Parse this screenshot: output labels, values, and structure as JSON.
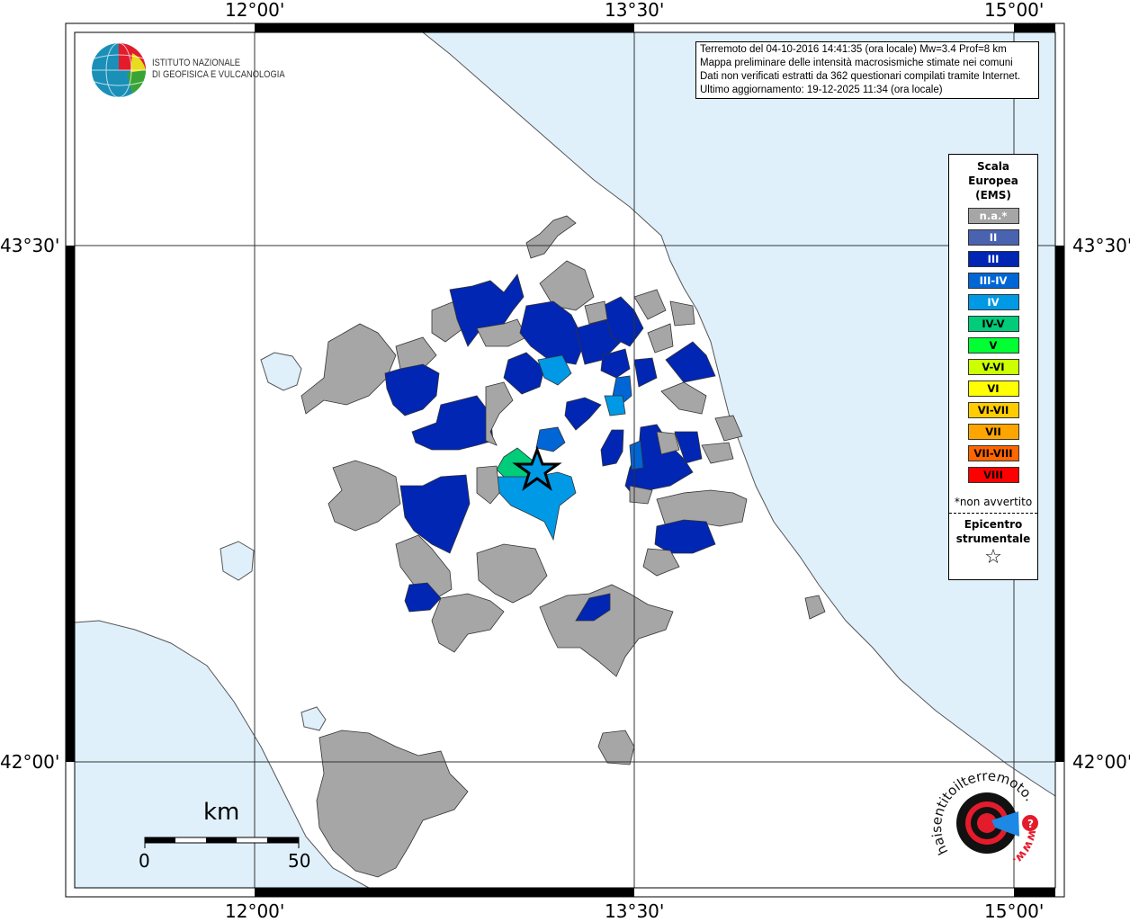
{
  "map": {
    "lon_ticks": [
      "12°00'",
      "13°30'",
      "15°00'"
    ],
    "lat_ticks": [
      "43°30'",
      "42°00'"
    ],
    "sea_color": "#dff0fb",
    "land_color": "#ffffff",
    "na_color": "#a6a6a6"
  },
  "info": {
    "line1": "Terremoto del 04-10-2016 14:41:35 (ora locale) Mw=3.4 Prof=8 km",
    "line2": "Mappa preliminare delle intensità macrosismiche stimate nei comuni",
    "line3": "Dati non verificati estratti da 362 questionari compilati tramite Internet.",
    "line4": "Ultimo aggiornamento: 19-12-2025 11:34 (ora locale)"
  },
  "logo": {
    "ingv_line1": "ISTITUTO NAZIONALE",
    "ingv_line2": "DI GEOFISICA E VULCANOLOGIA",
    "hst": "www.haisentitoilterremoto.it"
  },
  "legend": {
    "title1": "Scala",
    "title2": "Europea",
    "title3": "(EMS)",
    "classes": [
      {
        "label": "n.a.*",
        "color": "#a6a6a6",
        "text": "#ffffff"
      },
      {
        "label": "II",
        "color": "#4a63b0",
        "text": "#ffffff"
      },
      {
        "label": "III",
        "color": "#0026b3",
        "text": "#ffffff"
      },
      {
        "label": "III-IV",
        "color": "#0066d6",
        "text": "#ffffff"
      },
      {
        "label": "IV",
        "color": "#0099e6",
        "text": "#ffffff"
      },
      {
        "label": "IV-V",
        "color": "#00cc7a",
        "text": "#000000"
      },
      {
        "label": "V",
        "color": "#00ff33",
        "text": "#000000"
      },
      {
        "label": "V-VI",
        "color": "#ccff00",
        "text": "#000000"
      },
      {
        "label": "VI",
        "color": "#ffff00",
        "text": "#000000"
      },
      {
        "label": "VI-VII",
        "color": "#ffcc00",
        "text": "#000000"
      },
      {
        "label": "VII",
        "color": "#ffa500",
        "text": "#000000"
      },
      {
        "label": "VII-VIII",
        "color": "#ff6600",
        "text": "#000000"
      },
      {
        "label": "VIII",
        "color": "#ff0000",
        "text": "#000000"
      }
    ],
    "note": "*non avvertito",
    "epicenter1": "Epicentro",
    "epicenter2": "strumentale",
    "epicenter_icon": "star-outline-icon"
  },
  "scalebar": {
    "unit": "km",
    "start": "0",
    "end": "50"
  }
}
